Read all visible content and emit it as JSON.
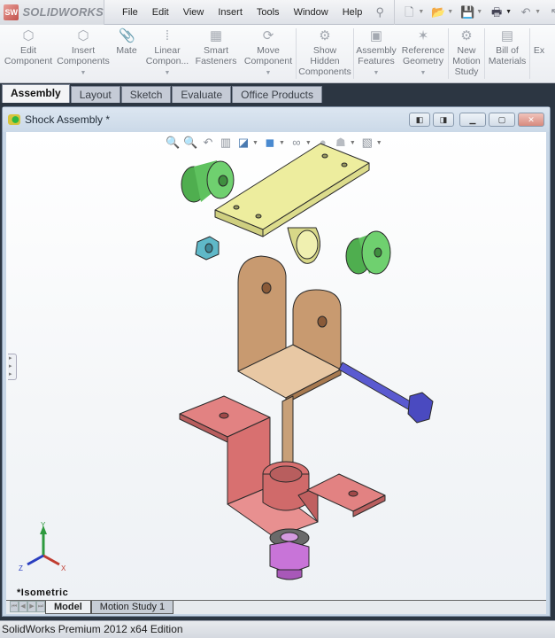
{
  "app": {
    "logo_text": "SOLIDWORKS",
    "logo_badge": "SW"
  },
  "menu": [
    "File",
    "Edit",
    "View",
    "Insert",
    "Tools",
    "Window",
    "Help"
  ],
  "quick_access": [
    {
      "icon": "pin-icon",
      "glyph": "⚲"
    },
    {
      "icon": "new-document-icon",
      "glyph": "🗋"
    },
    {
      "icon": "open-icon",
      "glyph": "📂"
    },
    {
      "icon": "save-icon",
      "glyph": "💾"
    },
    {
      "icon": "print-icon",
      "glyph": "🖶"
    },
    {
      "icon": "undo-icon",
      "glyph": "↶"
    },
    {
      "icon": "select-icon",
      "glyph": "↖"
    }
  ],
  "commands": [
    {
      "label": "Edit\nComponent",
      "icon": "edit-component-icon",
      "glyph": "⬡",
      "dropdown": false
    },
    {
      "label": "Insert\nComponents",
      "icon": "insert-components-icon",
      "glyph": "⬡",
      "dropdown": true
    },
    {
      "label": "Mate",
      "icon": "mate-icon",
      "glyph": "📎",
      "dropdown": false
    },
    {
      "label": "Linear\nCompon...",
      "icon": "linear-pattern-icon",
      "glyph": "⁞",
      "dropdown": true
    },
    {
      "label": "Smart\nFasteners",
      "icon": "smart-fasteners-icon",
      "glyph": "▦",
      "dropdown": false
    },
    {
      "label": "Move\nComponent",
      "icon": "move-component-icon",
      "glyph": "⟳",
      "dropdown": true
    },
    {
      "label": "Show\nHidden\nComponents",
      "icon": "show-hidden-icon",
      "glyph": "⚙",
      "dropdown": false
    },
    {
      "label": "Assembly\nFeatures",
      "icon": "assembly-features-icon",
      "glyph": "▣",
      "dropdown": true
    },
    {
      "label": "Reference\nGeometry",
      "icon": "reference-geometry-icon",
      "glyph": "✶",
      "dropdown": true
    },
    {
      "label": "New\nMotion\nStudy",
      "icon": "motion-study-icon",
      "glyph": "⚙",
      "dropdown": false
    },
    {
      "label": "Bill of\nMaterials",
      "icon": "bill-of-materials-icon",
      "glyph": "▤",
      "dropdown": false
    },
    {
      "label": "Ex",
      "icon": "",
      "glyph": "",
      "dropdown": false
    }
  ],
  "tabs": [
    {
      "label": "Assembly",
      "active": true
    },
    {
      "label": "Layout",
      "active": false
    },
    {
      "label": "Sketch",
      "active": false
    },
    {
      "label": "Evaluate",
      "active": false
    },
    {
      "label": "Office Products",
      "active": false
    }
  ],
  "document": {
    "title": "Shock Assembly *",
    "view_label": "*Isometric",
    "window_buttons": [
      {
        "name": "tile-left-button",
        "glyph": "◧"
      },
      {
        "name": "tile-right-button",
        "glyph": "◨"
      },
      {
        "name": "minimize-button",
        "glyph": "▁"
      },
      {
        "name": "restore-button",
        "glyph": "▢"
      },
      {
        "name": "close-button",
        "glyph": "✕"
      }
    ],
    "heads_up_toolbar": [
      {
        "icon": "zoom-to-fit-icon",
        "glyph": "🔍",
        "dropdown": false
      },
      {
        "icon": "zoom-to-area-icon",
        "glyph": "🔍",
        "dropdown": false
      },
      {
        "icon": "previous-view-icon",
        "glyph": "↶",
        "dropdown": false
      },
      {
        "icon": "section-view-icon",
        "glyph": "▥",
        "dropdown": false
      },
      {
        "icon": "view-orientation-icon",
        "glyph": "◪",
        "dropdown": true
      },
      {
        "icon": "display-style-icon",
        "glyph": "◼",
        "dropdown": true
      },
      {
        "icon": "hide-show-items-icon",
        "glyph": "∞",
        "dropdown": true
      },
      {
        "icon": "edit-appearance-icon",
        "glyph": "●",
        "dropdown": false
      },
      {
        "icon": "apply-scene-icon",
        "glyph": "☗",
        "dropdown": true
      },
      {
        "icon": "view-settings-icon",
        "glyph": "▧",
        "dropdown": true
      }
    ],
    "triad_axes": [
      "X",
      "Y",
      "Z"
    ],
    "bottom_tabs": [
      {
        "label": "Model",
        "active": true
      },
      {
        "label": "Motion Study 1",
        "active": false
      }
    ],
    "parts": [
      {
        "name": "top-bracket",
        "color": "#e6e69a"
      },
      {
        "name": "bushing-left",
        "color": "#5fc25f"
      },
      {
        "name": "bushing-right",
        "color": "#5fc25f"
      },
      {
        "name": "hex-nut-small",
        "color": "#5fb8c8"
      },
      {
        "name": "clevis-yoke",
        "color": "#c89a70"
      },
      {
        "name": "bolt",
        "color": "#5a5ad0"
      },
      {
        "name": "base-bracket",
        "color": "#e07c7c"
      },
      {
        "name": "washer",
        "color": "#6a6a6a"
      },
      {
        "name": "bottom-nut",
        "color": "#c874d8"
      }
    ]
  },
  "status_bar": {
    "text": "SolidWorks Premium 2012 x64 Edition"
  }
}
